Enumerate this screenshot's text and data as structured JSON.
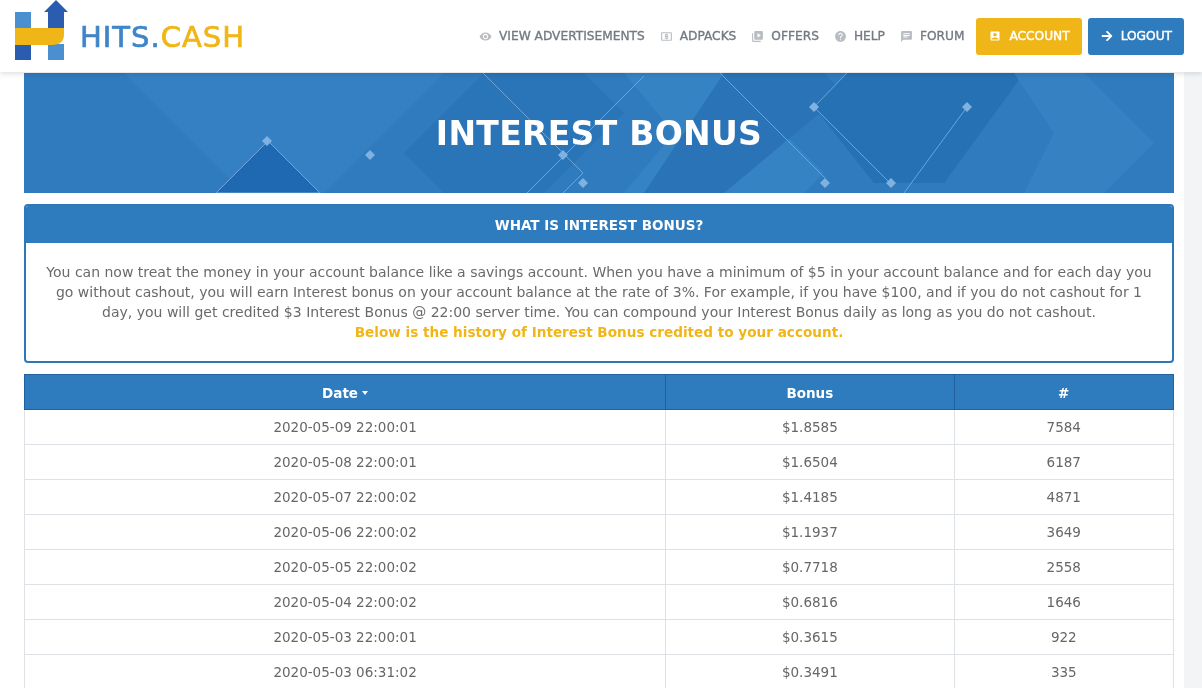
{
  "header": {
    "logo": {
      "text_primary": "HITS.",
      "text_accent": "CASH"
    },
    "nav": [
      {
        "label": "VIEW ADVERTISEMENTS",
        "kind": "link"
      },
      {
        "label": "ADPACKS",
        "kind": "link"
      },
      {
        "label": "OFFERS",
        "kind": "link"
      },
      {
        "label": "HELP",
        "kind": "link"
      },
      {
        "label": "FORUM",
        "kind": "link"
      },
      {
        "label": "ACCOUNT",
        "kind": "accent"
      },
      {
        "label": "LOGOUT",
        "kind": "primary"
      }
    ]
  },
  "banner": {
    "title": "INTEREST BONUS"
  },
  "info_panel": {
    "title": "WHAT IS INTEREST BONUS?",
    "text": "You can now treat the money in your account balance like a savings account. When you have a minimum of $5 in your account balance and for each day you go without cashout, you will earn Interest bonus on your account balance at the rate of 3%. For example, if you have $100, and if you do not cashout for 1 day, you will get credited $3 Interest Bonus @ 22:00 server time. You can compound your Interest Bonus daily as long as you do not cashout.",
    "note": "Below is the history of Interest Bonus credited to your account."
  },
  "table": {
    "columns": [
      {
        "label": "Date",
        "sorted": true
      },
      {
        "label": "Bonus",
        "sorted": false
      },
      {
        "label": "#",
        "sorted": false
      }
    ],
    "rows": [
      [
        "2020-05-09 22:00:01",
        "$1.8585",
        "7584"
      ],
      [
        "2020-05-08 22:00:01",
        "$1.6504",
        "6187"
      ],
      [
        "2020-05-07 22:00:02",
        "$1.4185",
        "4871"
      ],
      [
        "2020-05-06 22:00:02",
        "$1.1937",
        "3649"
      ],
      [
        "2020-05-05 22:00:02",
        "$0.7718",
        "2558"
      ],
      [
        "2020-05-04 22:00:02",
        "$0.6816",
        "1646"
      ],
      [
        "2020-05-03 22:00:01",
        "$0.3615",
        "922"
      ],
      [
        "2020-05-03 06:31:02",
        "$0.3491",
        "335"
      ]
    ]
  }
}
